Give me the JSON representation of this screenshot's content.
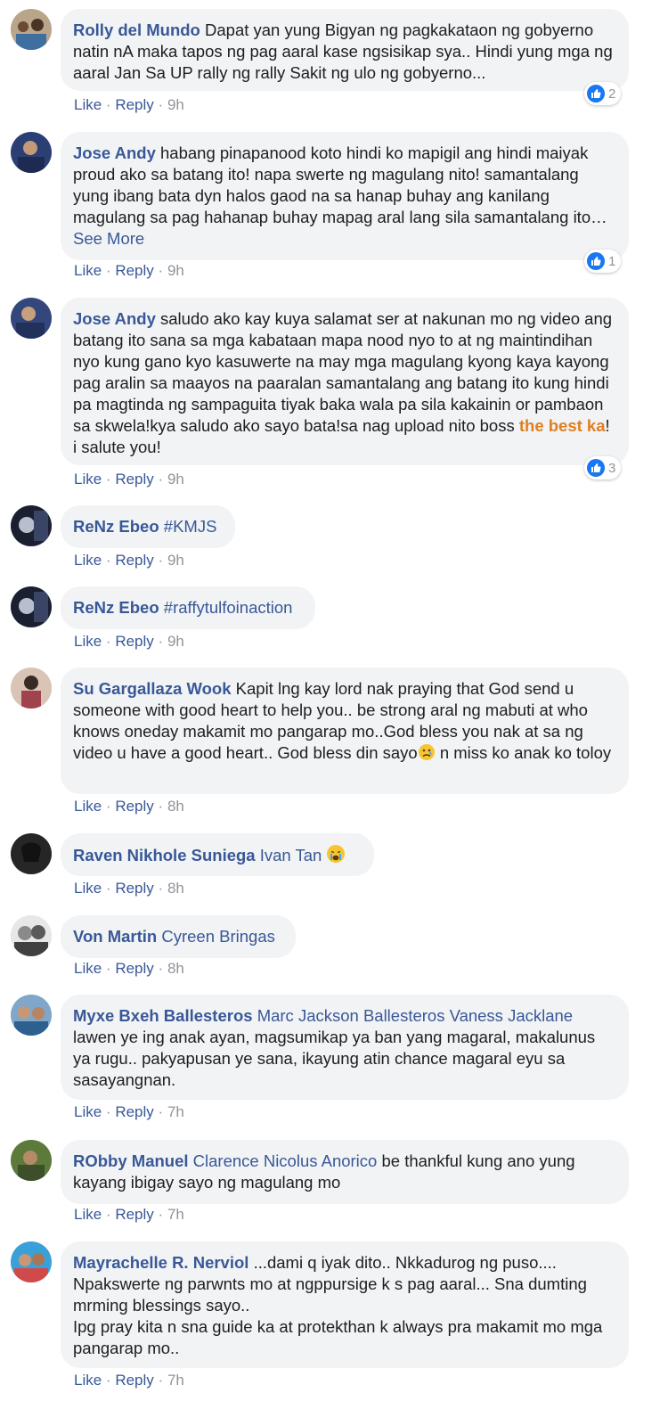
{
  "colors": {
    "author": "#385898",
    "bubble": "#f2f3f5",
    "meta": "#90949c",
    "highlight": "#e07f1f",
    "like_badge": "#1877f2"
  },
  "actions": {
    "like": "Like",
    "reply": "Reply",
    "sep": "·"
  },
  "comments": [
    {
      "author": "Rolly del Mundo",
      "text": "Dapat yan yung Bigyan ng pagkakataon ng gobyerno natin nA maka tapos ng pag aaral kase ngsisikap sya.. Hindi yung mga ng aaral Jan Sa UP rally ng rally Sakit ng ulo ng gobyerno...",
      "time": "9h",
      "reactions": "2"
    },
    {
      "author": "Jose Andy",
      "text": "habang pinapanood koto hindi ko mapigil ang hindi maiyak proud ako sa batang ito! napa swerte ng magulang nito! samantalang yung ibang bata dyn halos gaod na sa hanap buhay ang kanilang magulang sa pag hahanap buhay mapag aral lang sila samantalang ito…",
      "see_more": "See More",
      "time": "9h",
      "reactions": "1"
    },
    {
      "author": "Jose Andy",
      "text_before": "saludo ako kay kuya salamat ser at nakunan mo ng video ang batang ito sana sa mga kabataan mapa nood nyo to at ng maintindihan nyo kung gano kyo kasuwerte na may mga magulang kyong kaya kayong pag aralin sa maayos na paaralan samantalang ang batang ito kung hindi pa magtinda ng sampaguita tiyak baka wala pa sila kakainin or pambaon sa skwela!kya saludo ako sayo bata!sa nag upload nito boss",
      "highlight": "the best ka",
      "text_after": "! i salute you!",
      "time": "9h",
      "reactions": "3"
    },
    {
      "author": "ReNz Ebeo",
      "text": "#KMJS",
      "time": "9h"
    },
    {
      "author": "ReNz Ebeo",
      "text": "#raffytulfoinaction",
      "time": "9h"
    },
    {
      "author": "Su Gargallaza Wook",
      "text_before": "Kapit lng kay lord nak praying that God send u someone with good heart to help you.. be strong aral ng mabuti at who knows oneday makamit mo pangarap mo..God bless you nak at sa ng video u have a good heart.. God bless din sayo",
      "emoji": "sad-emoji",
      "text_after": " n miss ko anak ko toloy",
      "time": "8h"
    },
    {
      "author": "Raven Nikhole Suniega",
      "tag": "Ivan Tan",
      "emoji": "crying-emoji",
      "time": "8h"
    },
    {
      "author": "Von Martin",
      "tag": "Cyreen Bringas",
      "time": "8h"
    },
    {
      "author": "Myxe Bxeh Ballesteros",
      "tag": "Marc Jackson Ballesteros Vaness Jacklane",
      "text": "lawen ye ing anak ayan, magsumikap ya ban yang magaral, makalunus ya rugu.. pakyapusan ye sana, ikayung atin chance magaral eyu sa sasayangnan.",
      "time": "7h"
    },
    {
      "author": "RObby Manuel",
      "tag": "Clarence Nicolus Anorico",
      "text": "be thankful kung ano yung kayang ibigay sayo ng magulang mo",
      "time": "7h"
    },
    {
      "author": "Mayrachelle R. Nerviol",
      "text": "...dami q iyak dito.. Nkkadurog ng puso.... Npakswerte ng parwnts mo at ngppursige k s pag aaral... Sna dumting mrming blessings sayo..",
      "text2": "Ipg pray kita n sna guide ka at protekthan k always pra makamit mo mga pangarap mo..",
      "time": "7h"
    }
  ]
}
